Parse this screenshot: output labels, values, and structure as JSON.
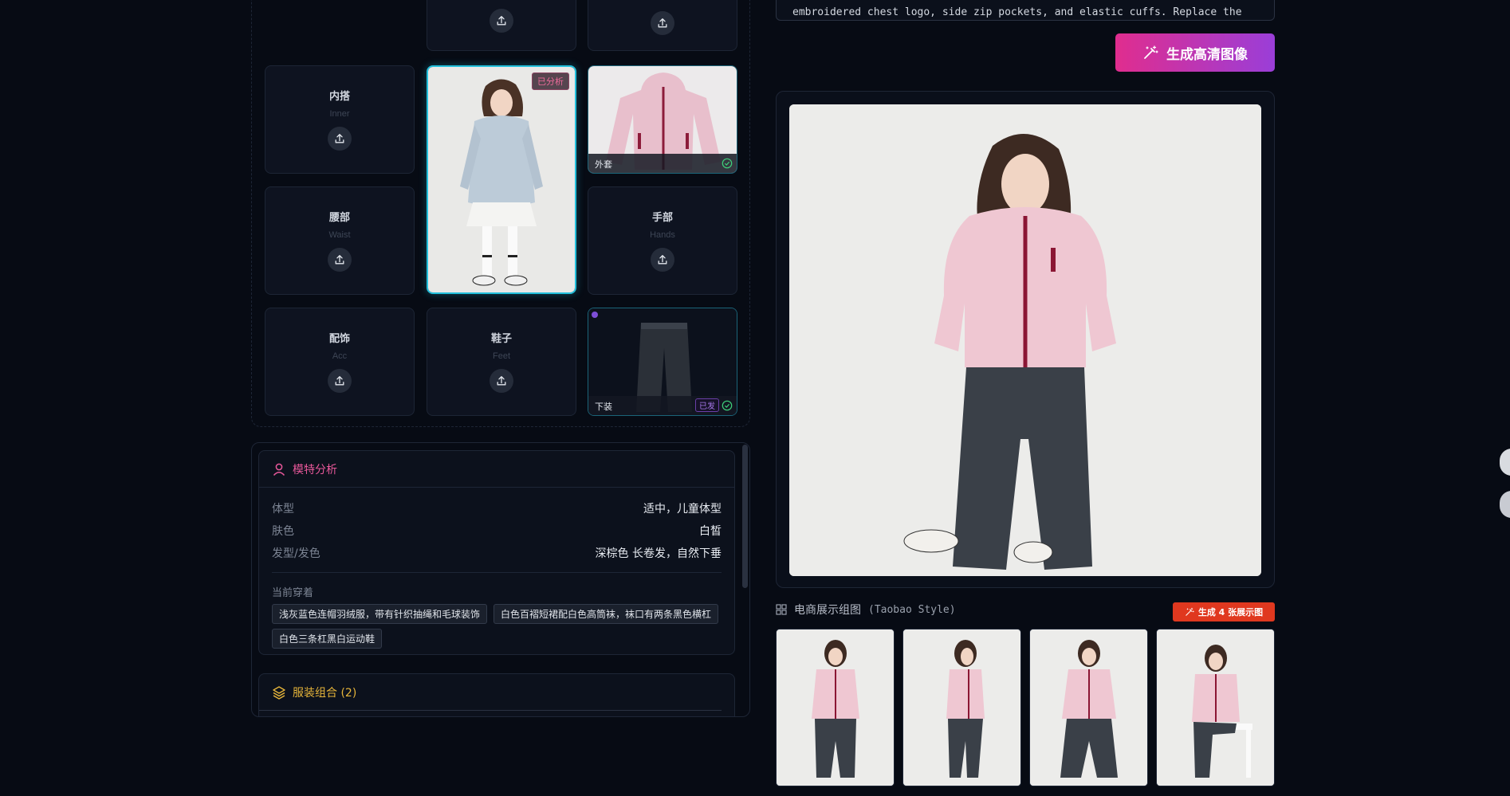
{
  "slots": {
    "inner": {
      "zh": "内搭",
      "en": "Inner"
    },
    "waist": {
      "zh": "腰部",
      "en": "Waist"
    },
    "hands": {
      "zh": "手部",
      "en": "Hands"
    },
    "acc": {
      "zh": "配饰",
      "en": "Acc"
    },
    "feet": {
      "zh": "鞋子",
      "en": "Feet"
    },
    "outer_caption": "外套",
    "bottom_caption": "下装",
    "bottom_badge": "已发",
    "model_badge": "已分析"
  },
  "analysis": {
    "title": "模特分析",
    "rows": [
      {
        "k": "体型",
        "v": "适中，儿童体型"
      },
      {
        "k": "肤色",
        "v": "白皙"
      },
      {
        "k": "发型/发色",
        "v": "深棕色 长卷发，自然下垂"
      }
    ],
    "current_label": "当前穿着",
    "tags": [
      "浅灰蓝色连帽羽绒服，带有针织抽绳和毛球装饰",
      "白色百褶短裙配白色高筒袜，袜口有两条黑色横杠",
      "白色三条杠黑白运动鞋"
    ],
    "combo_title": "服装组合 (2)"
  },
  "prompt_text": "embroidered chest logo, side zip pockets, and elastic cuffs. Replace the",
  "generate_hd_label": "生成高清图像",
  "gallery": {
    "title": "电商展示组图",
    "subtitle": "(Taobao Style)",
    "generate_label": "生成 4 张展示图"
  },
  "colors": {
    "accent_pink": "#e02d8e",
    "accent_purple": "#9a3ed8",
    "accent_cyan": "#22c0dc",
    "accent_orange": "#e0381f",
    "gold": "#e5b43a"
  },
  "icons": [
    "upload-icon",
    "check-circle-icon",
    "user-icon",
    "layers-icon",
    "magic-wand-icon",
    "grid-icon"
  ]
}
